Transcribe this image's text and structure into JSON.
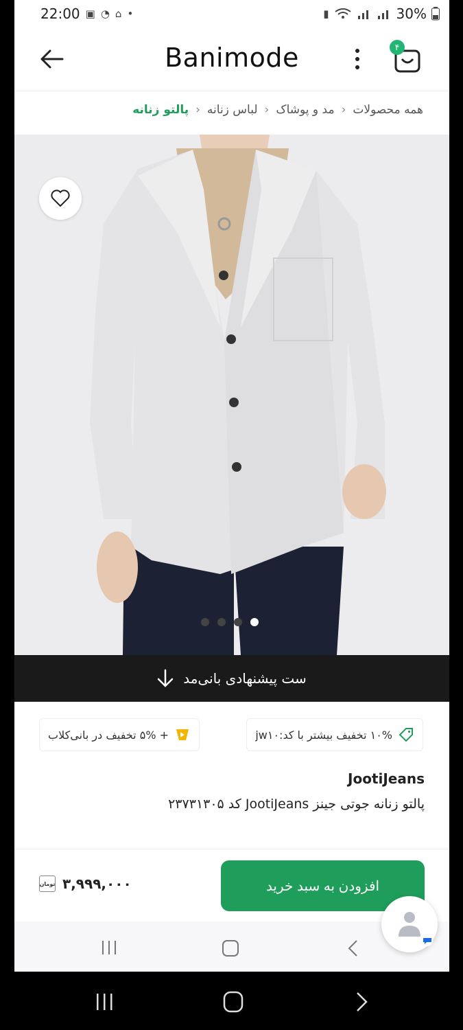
{
  "status": {
    "time": "22:00",
    "battery": "30%"
  },
  "header": {
    "logo": "Banimode",
    "cart_count": "۴"
  },
  "breadcrumb": [
    "همه محصولات",
    "مد و پوشاک",
    "لباس زنانه",
    "پالتو زنانه"
  ],
  "gallery": {
    "dots_total": 4,
    "active_dot": 4
  },
  "set_banner": {
    "label": "ست پیشنهادی بانی‌مد"
  },
  "promos": {
    "discount_code": "۱۰% تخفیف بیشتر با کد:jw۱۰",
    "club": "+ ۵% تخفیف در بانی‌کلاب"
  },
  "product": {
    "brand": "JootiJeans",
    "title": "پالتو زنانه جوتی جینز JootiJeans کد ۲۳۷۳۱۳۰۵",
    "price": "۳,۹۹۹,۰۰۰",
    "currency": "تومان"
  },
  "actions": {
    "add_to_cart": "افزودن به سبد خرید"
  },
  "colors": {
    "accent": "#1e9e5a",
    "banner": "#1a1a1a"
  }
}
